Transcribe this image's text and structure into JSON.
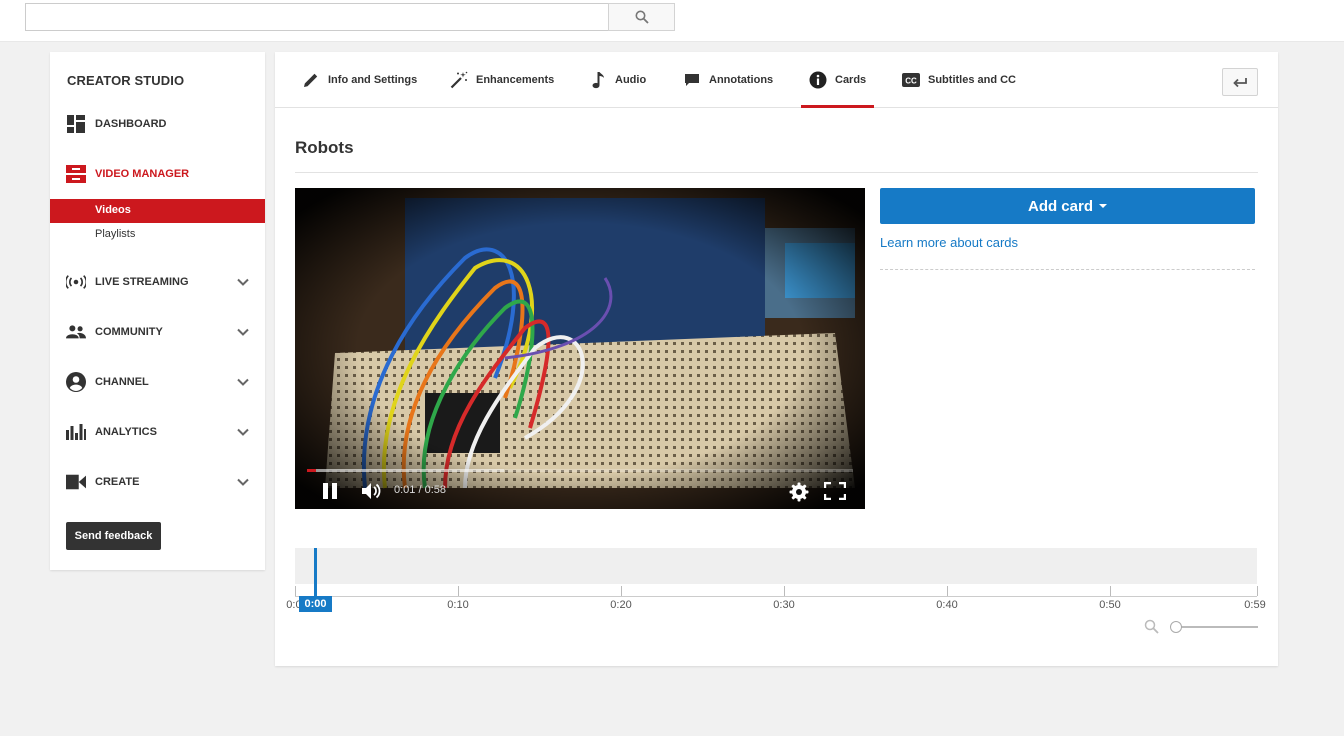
{
  "search": {
    "value": "",
    "placeholder": ""
  },
  "sidebar": {
    "title": "CREATOR STUDIO",
    "items": [
      {
        "label": "DASHBOARD"
      },
      {
        "label": "VIDEO MANAGER"
      },
      {
        "label": "LIVE STREAMING"
      },
      {
        "label": "COMMUNITY"
      },
      {
        "label": "CHANNEL"
      },
      {
        "label": "ANALYTICS"
      },
      {
        "label": "CREATE"
      }
    ],
    "sub_items": [
      {
        "label": "Videos"
      },
      {
        "label": "Playlists"
      }
    ],
    "feedback_label": "Send feedback"
  },
  "tabs": [
    {
      "label": "Info and Settings",
      "icon": "pencil-icon"
    },
    {
      "label": "Enhancements",
      "icon": "magic-wand-icon"
    },
    {
      "label": "Audio",
      "icon": "music-note-icon"
    },
    {
      "label": "Annotations",
      "icon": "speech-bubble-icon"
    },
    {
      "label": "Cards",
      "icon": "info-circle-icon"
    },
    {
      "label": "Subtitles and CC",
      "icon": "cc-icon"
    }
  ],
  "active_tab": "Cards",
  "video": {
    "title": "Robots",
    "current_time": "0:01",
    "duration": "0:58",
    "time_text": "0:01 / 0:58",
    "progress_fraction": 0.017,
    "buffered_fraction": 0.36
  },
  "cards": {
    "add_label": "Add card",
    "learn_more": "Learn more about cards"
  },
  "timeline": {
    "ticks": [
      "0:00",
      "0:10",
      "0:20",
      "0:30",
      "0:40",
      "0:50",
      "0:59"
    ],
    "playhead_label": "0:00"
  },
  "colors": {
    "accent_red": "#cc181e",
    "accent_blue": "#167ac6"
  }
}
